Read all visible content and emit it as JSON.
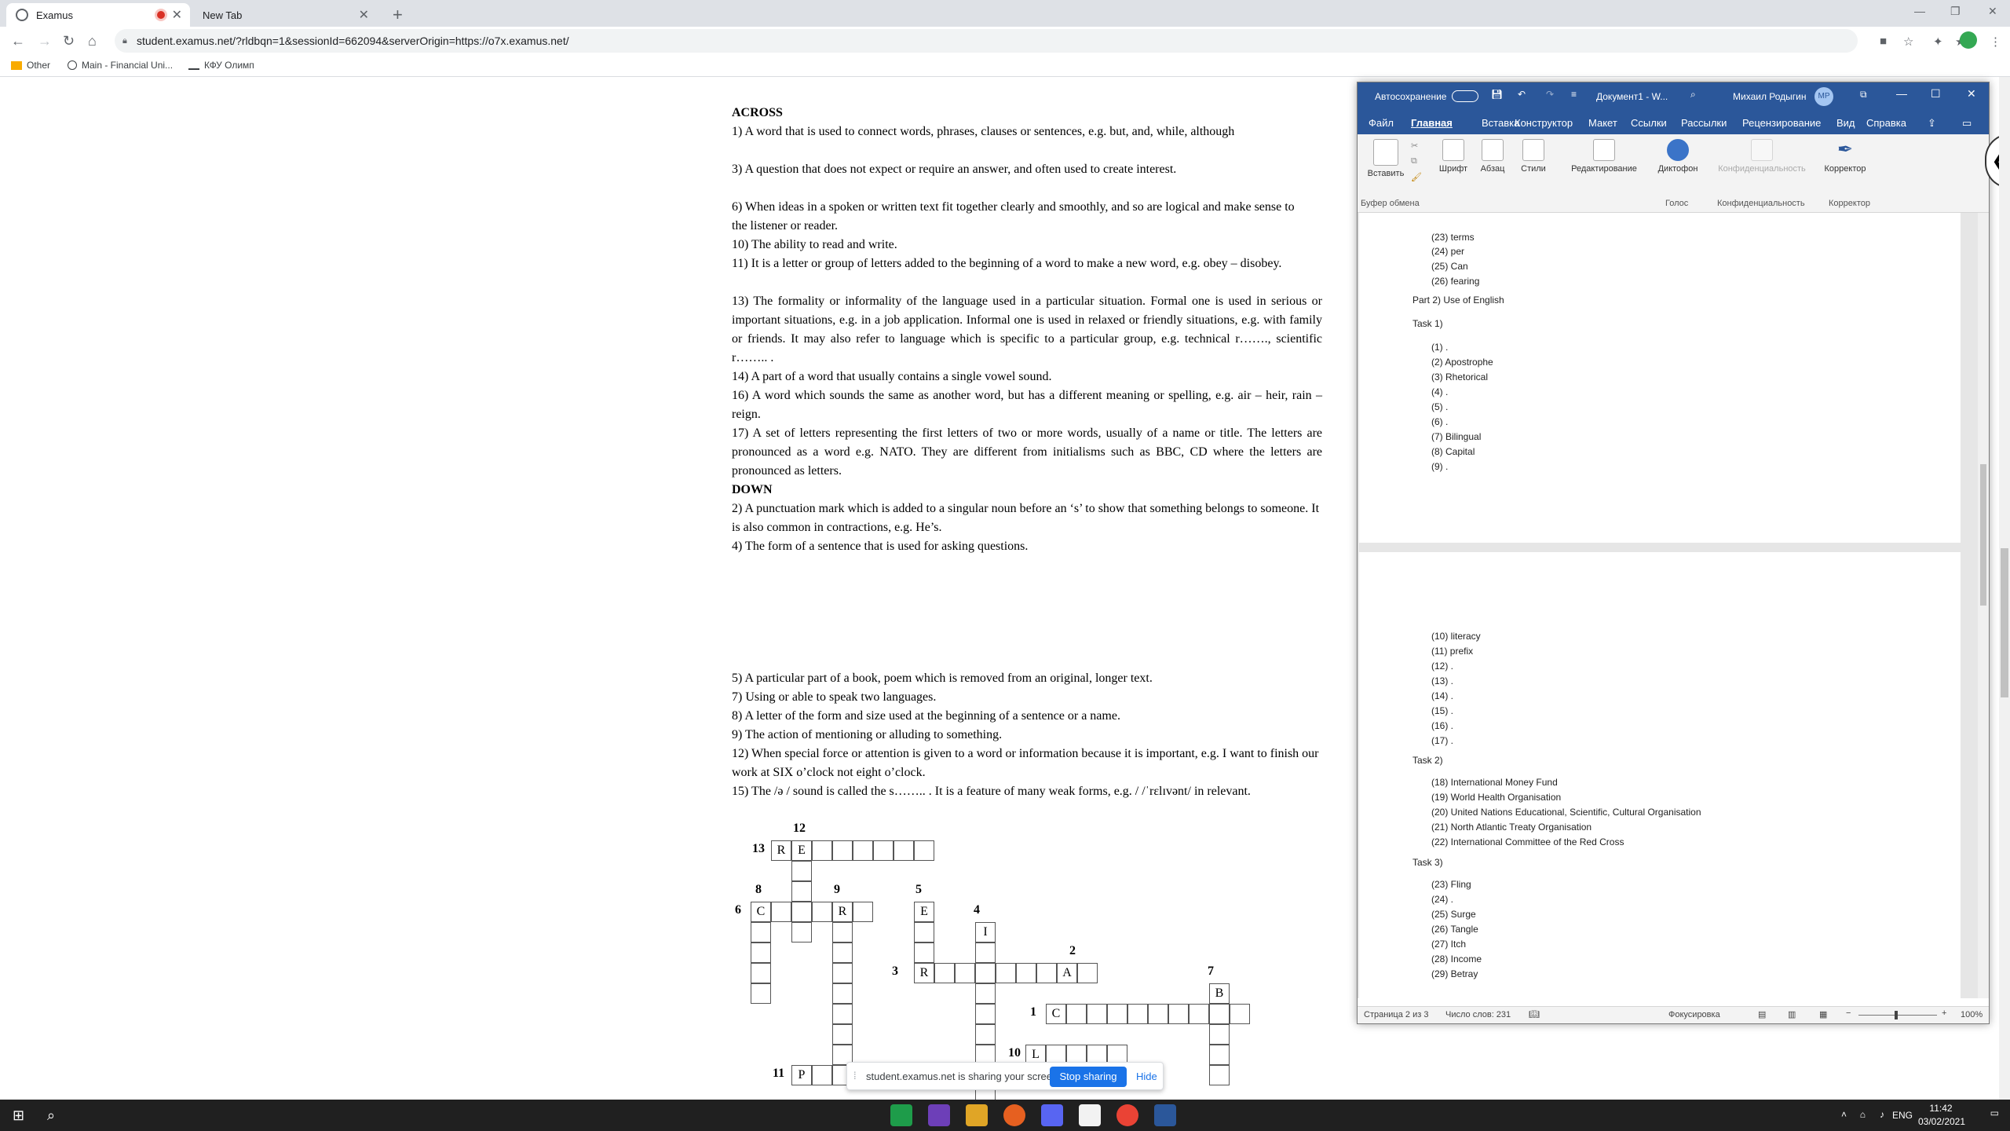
{
  "browser": {
    "tabs": [
      {
        "label": "Examus",
        "recording": true
      },
      {
        "label": "New Tab"
      }
    ],
    "url": "student.examus.net/?rldbqn=1&sessionId=662094&serverOrigin=https://o7x.examus.net/",
    "bookmarks": [
      "Other",
      "Main - Financial Uni...",
      "КФУ Олимп"
    ]
  },
  "doc": {
    "across_title": "ACROSS",
    "across": [
      "1) A word that is used to connect words, phrases, clauses or sentences, e.g. but, and, while, although",
      "3) A question that does not expect or require an answer, and often used to create interest.",
      "6) When ideas in a spoken or written text fit together clearly and smoothly, and so are logical and make sense to the listener or reader.",
      "10) The ability to read and write.",
      "11) It is a letter or group of letters added to the beginning of a word to make a new word, e.g. obey – disobey.",
      "13) The formality or informality of the language used in a particular situation. Formal one is used in serious or important situations, e.g. in a job application. Informal one is used in relaxed or friendly situations, e.g. with family or friends. It may also refer to language which is specific to a particular group, e.g. technical r……., scientific r…….. .",
      "14) A part of a word that usually contains a single vowel sound.",
      "16) A word which sounds the same as another word, but has a different meaning or spelling, e.g. air – heir, rain – reign.",
      "17) A set of letters representing the first letters of two or more words, usually of a name or title. The letters are pronounced as a word e.g. NATO. They are different from initialisms such as BBC, CD where the letters are pronounced as letters."
    ],
    "down_title": "DOWN",
    "down": [
      "2) A punctuation mark which is added to a singular noun before an ‘s’ to show that something belongs to someone. It is also common in contractions, e.g. He’s.",
      "4) The form of a sentence that is used for asking questions.",
      "5) A particular part of a book, poem which is removed from an original, longer text.",
      "7) Using or able to speak two languages.",
      "8) A letter of the form and size used at the beginning of a sentence or a name.",
      "9) The action of mentioning or alluding to something.",
      "12) When special force or attention is given to a word or information because it is important, e.g. I want to finish our work at SIX o’clock not eight  o’clock.",
      "15) The /ə / sound is called the s…….. . It is a feature of many weak forms, e.g. / /ˈrɛlɪvənt/ in relevant."
    ],
    "crossword": {
      "numbers": [
        "12",
        "13",
        "8",
        "9",
        "5",
        "6",
        "4",
        "2",
        "3",
        "7",
        "1",
        "10",
        "11"
      ],
      "letters": [
        "R",
        "E",
        "C",
        "R",
        "E",
        "I",
        "R",
        "A",
        "B",
        "C",
        "L",
        "P"
      ]
    }
  },
  "sharebar": {
    "message": "student.examus.net is sharing your screen.",
    "stop": "Stop sharing",
    "hide": "Hide"
  },
  "word": {
    "title": {
      "autosave": "Автосохранение",
      "doc": "Документ1 - W...",
      "user": "Михаил Родыгин",
      "initials": "МР"
    },
    "tabs": [
      "Файл",
      "Главная",
      "Вставка",
      "Конструктор",
      "Макет",
      "Ссылки",
      "Рассылки",
      "Рецензирование",
      "Вид",
      "Справка"
    ],
    "ribbon": {
      "buttons": [
        "Вставить",
        "Шрифт",
        "Абзац",
        "Стили",
        "Редактирование",
        "Диктофон",
        "Конфиденциальность",
        "Корректор"
      ],
      "groups": [
        "Буфер обмена",
        "Голос",
        "Конфиденциальность",
        "Корректор"
      ]
    },
    "page1": [
      "(23) terms",
      "(24) per",
      "(25) Can",
      "(26) fearing",
      "Part 2) Use of English",
      "Task 1)",
      "(1)  .",
      "(2)  Apostrophe",
      "(3)  Rhetorical",
      "(4)  .",
      "(5)  .",
      "(6)  .",
      "(7)  Bilingual",
      "(8)  Capital",
      "(9)  ."
    ],
    "page2": [
      "(10) literacy",
      "(11) prefix",
      "(12) .",
      "(13) .",
      "(14) .",
      "(15) .",
      "(16) .",
      "(17) .",
      "Task 2)",
      "(18) International Money Fund",
      "(19) World Health Organisation",
      "(20) United Nations Educational, Scientific, Cultural Organisation",
      "(21) North Atlantic Treaty Organisation",
      "(22) International Committee of the Red Cross",
      "Task 3)",
      "(23) Fling",
      "(24) .",
      "(25) Surge",
      "(26) Tangle",
      "(27) Itch",
      "(28) Income",
      "(29) Betray"
    ],
    "status": {
      "page": "Страница 2 из 3",
      "words": "Число слов: 231",
      "focus": "Фокусировка",
      "zoom": "100%"
    }
  },
  "taskbar": {
    "lang": "ENG",
    "time": "11:42",
    "date": "03/02/2021"
  }
}
